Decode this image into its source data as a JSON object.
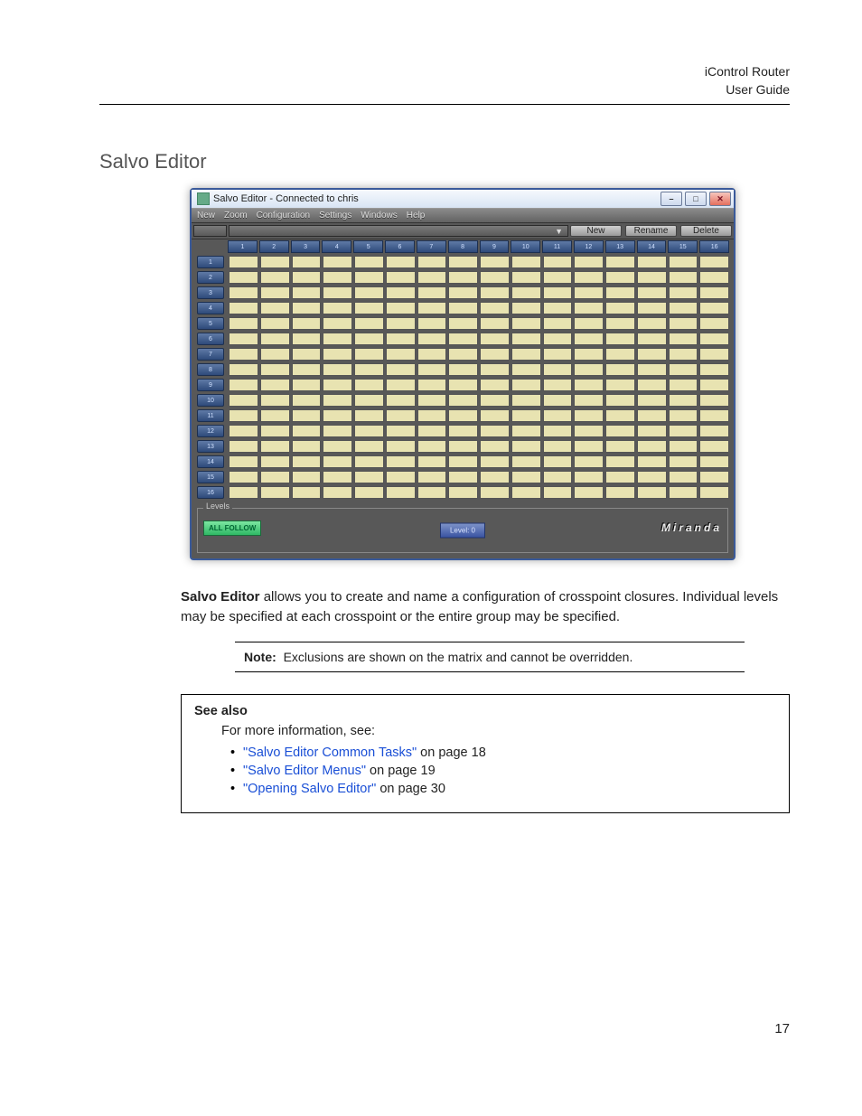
{
  "header": {
    "product": "iControl Router",
    "doc": "User Guide"
  },
  "section_heading": "Salvo Editor",
  "app": {
    "title": "Salvo Editor - Connected to chris",
    "menus": [
      "New",
      "Zoom",
      "Configuration",
      "Settings",
      "Windows",
      "Help"
    ],
    "toolbar": {
      "dropdown_caret": "▼",
      "new_btn": "New",
      "rename_btn": "Rename",
      "delete_btn": "Delete"
    },
    "grid": {
      "columns": [
        "1",
        "2",
        "3",
        "4",
        "5",
        "6",
        "7",
        "8",
        "9",
        "10",
        "11",
        "12",
        "13",
        "14",
        "15",
        "16"
      ],
      "rows": [
        "1",
        "2",
        "3",
        "4",
        "5",
        "6",
        "7",
        "8",
        "9",
        "10",
        "11",
        "12",
        "13",
        "14",
        "15",
        "16"
      ]
    },
    "levels": {
      "legend": "Levels",
      "all_follow": "ALL FOLLOW",
      "current": "Level: 0",
      "brand": "Miranda"
    }
  },
  "paragraph": {
    "lead": "Salvo Editor",
    "rest": " allows you to create and name a configuration of crosspoint closures. Individual levels may be specified at each crosspoint or the entire group may be specified."
  },
  "note": {
    "label": "Note:",
    "text": "Exclusions are shown on the matrix and cannot be overridden."
  },
  "seealso": {
    "title": "See also",
    "intro": "For more information, see:",
    "items": [
      {
        "link": "\"Salvo Editor Common Tasks\"",
        "suffix": " on page 18"
      },
      {
        "link": "\"Salvo Editor Menus\"",
        "suffix": " on page 19"
      },
      {
        "link": "\"Opening Salvo Editor\"",
        "suffix": " on page 30"
      }
    ]
  },
  "page_number": "17"
}
